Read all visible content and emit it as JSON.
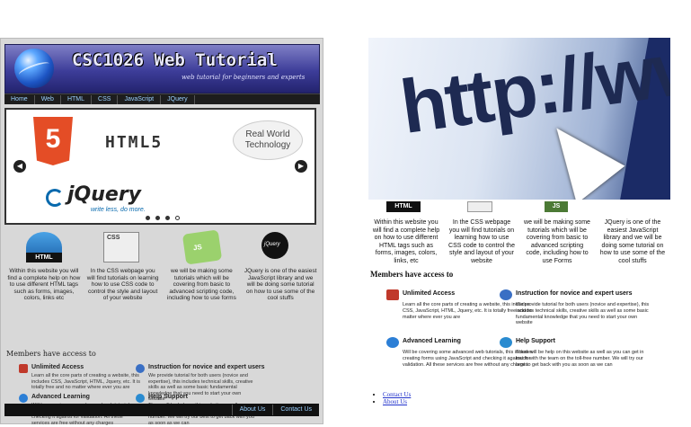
{
  "left": {
    "banner": {
      "title": "CSC1026 Web Tutorial",
      "subtitle": "web tutorial for beginners and experts"
    },
    "nav": [
      "Home",
      "Web",
      "HTML",
      "CSS",
      "JavaScript",
      "JQuery"
    ],
    "slider": {
      "html5_badge": "5",
      "html5_text": "HTML5",
      "rwt_text": "Real World Technology",
      "jquery_text": "jQuery",
      "jquery_tag": "write less, do more.",
      "prev_icon": "chevron-left-icon",
      "next_icon": "chevron-right-icon"
    },
    "icons": {
      "html": "HTML",
      "css": "CSS",
      "js": "JS",
      "jquery": "jQuery"
    },
    "features": [
      "Within this website you will find a complete help on how to use different HTML tags such as forms, images, colors, links etc",
      "In the CSS webpage you will find tutorials on learning how to use CSS code to control the style and layout of your website",
      "we will be making some tutorials which will be covering from basic to advanced scripting code, including how to use forms",
      "JQuery is one of the easiest JavaScript library and we will be doing some tutorial on how to use some of the cool stuffs"
    ],
    "members_title": "Members have access to",
    "members": [
      {
        "title": "Unlimited Access",
        "text": "Learn all the core parts of creating a website, this includes CSS, JavaScript, HTML, Jquery, etc. It is totally free and no matter where ever you are"
      },
      {
        "title": "Instruction for novice and expert users",
        "text": "We provide tutorial for both users (novice and expertise), this includes technical skills, creative skills as well as some basic fundamental knowledge that you need to start your own website"
      },
      {
        "title": "Advanced Learning",
        "text": "Will be covering some advanced web tutorials, this includes creating forms using JavaScript and checking it against for validation. All these services are free without any charges"
      },
      {
        "title": "Help Support",
        "text": "There will be help on this website as well as you can get in touch with the team on the toll-free number. We will try our best to get back with you as soon as we can"
      }
    ],
    "footer": [
      "About Us",
      "Contact Us"
    ]
  },
  "right": {
    "hero_text": "http://www",
    "icons": {
      "html": "HTML",
      "js": "JS"
    },
    "features": [
      "Within this website you will find a complete help on how to use different HTML tags such as forms, images, colors, links, etc",
      "In the CSS webpage you will find tutorials on learning how to use CSS code to control the style and layout of your website",
      "we will be making some tutorials which will be covering from basic to advanced scripting code, including how to use Forms",
      "JQuery is one of the easiest JavaScript library and we will be doing some tutorial on how to use some of the cool stuffs"
    ],
    "members_title": "Members have access to",
    "members": [
      {
        "title": "Unlimited Access",
        "text": "Learn all the core parts of creating a website, this includes CSS, JavaScript, HTML, Jquery, etc. It is totally free and no matter where ever you are"
      },
      {
        "title": "Instruction for novice and expert users",
        "text": "We provide tutorial for both users (novice and expertise), this includes technical skills, creative skills as well as some basic fundamental knowledge that you need to start your own website"
      },
      {
        "title": "Advanced Learning",
        "text": "Will be covering some advanced web tutorials, this includes creating forms using JavaScript and checking it against for validation. All these services are free without any charges"
      },
      {
        "title": "Help Support",
        "text": "There will be help on this website as well as you can get in touch with the team on the toll-free number. We will try our best to get back with you as soon as we can"
      }
    ],
    "links": [
      "Contact Us",
      "About Us"
    ]
  },
  "colors": {
    "banner": "#3d3d99",
    "nav_bg": "#1d1d1d",
    "nav_link": "#9ad0ff",
    "html5": "#e44d26",
    "link": "#2233cc"
  }
}
